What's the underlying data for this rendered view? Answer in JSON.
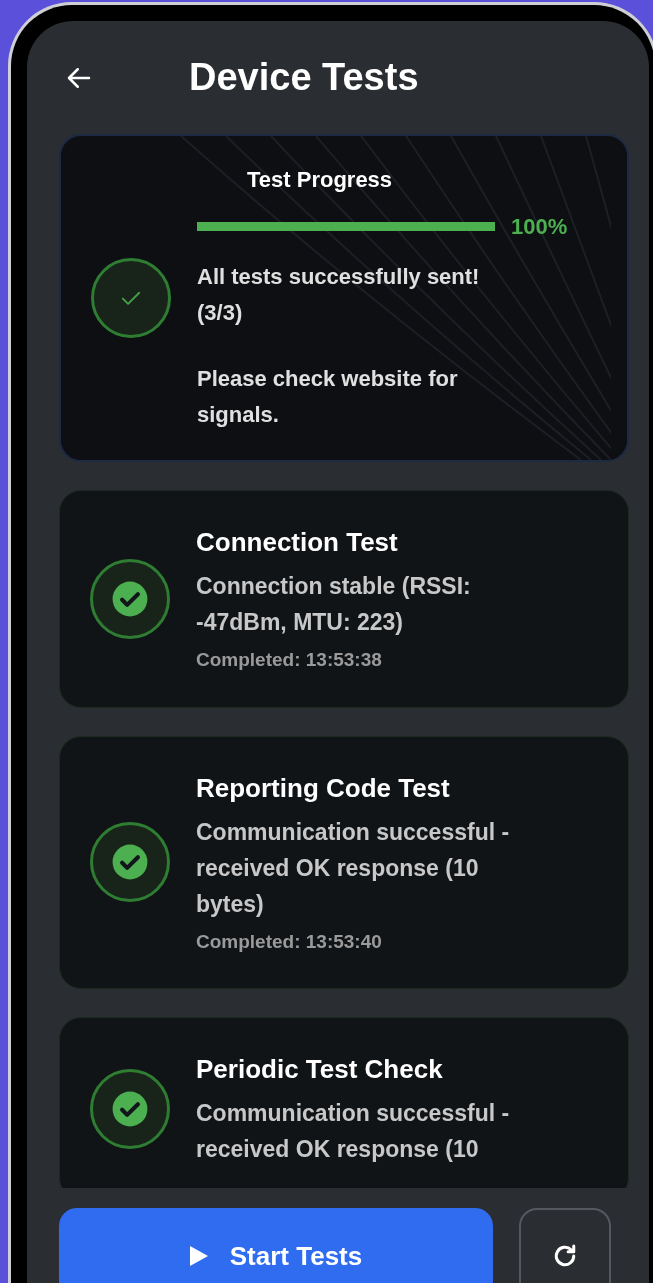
{
  "header": {
    "title": "Device Tests"
  },
  "progress": {
    "title": "Test Progress",
    "level": 1,
    "percent": "100%",
    "passed": true,
    "message": "All tests successfully sent! (3/3)",
    "note": "Please check website for signals."
  },
  "tests": [
    {
      "name": "Connection Test",
      "passed": true,
      "detail": "Connection stable (RSSI: -47dBm, MTU: 223)",
      "time": "Completed: 13:53:38"
    },
    {
      "name": "Reporting Code Test",
      "passed": true,
      "detail": "Communication successful - received OK response (10 bytes)",
      "time": "Completed: 13:53:40"
    },
    {
      "name": "Periodic Test Check",
      "passed": true,
      "detail": "Communication successful - received OK response (10"
    }
  ],
  "actions": {
    "start": "Start Tests"
  }
}
